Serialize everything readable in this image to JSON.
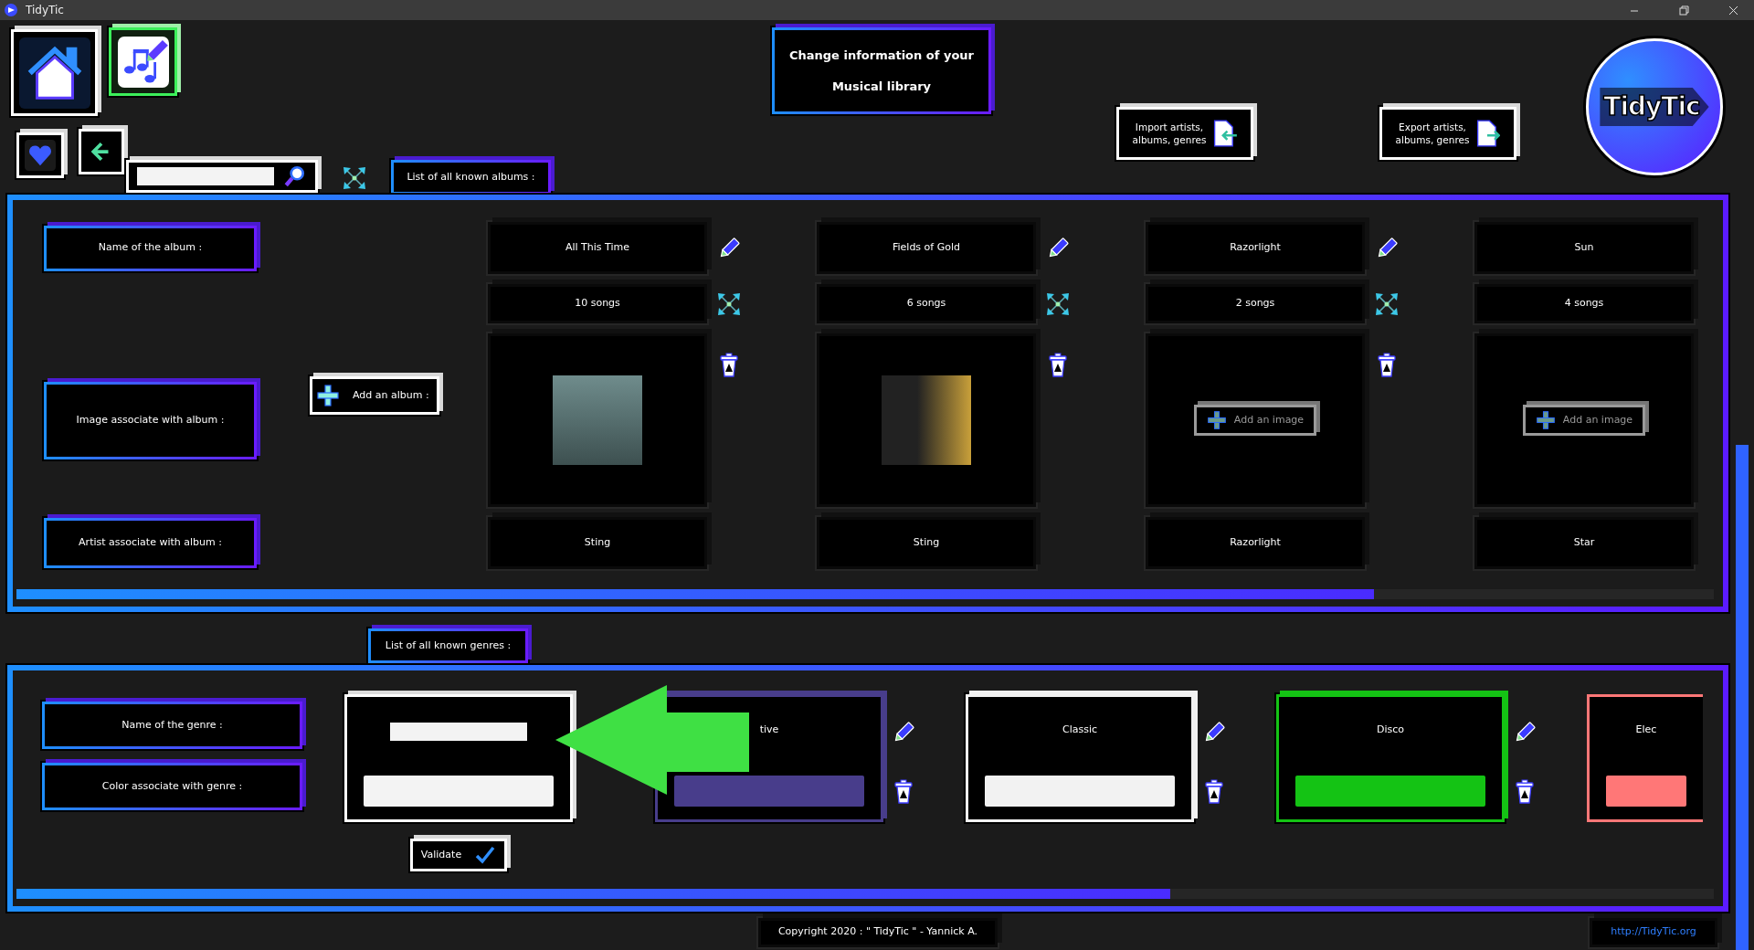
{
  "window": {
    "title": "TidyTic"
  },
  "header": {
    "heading_lines": [
      "Change information of your",
      "Musical library"
    ],
    "import_button_lines": [
      "Import artists,",
      "albums, genres"
    ],
    "export_button_lines": [
      "Export artists,",
      "albums, genres"
    ],
    "logo_text": "TidyTic"
  },
  "albums_tab": "List of all known albums :",
  "album_labels": [
    "Name of the album :",
    "Image associate with album :",
    "Artist associate with album :"
  ],
  "add_album_button": "Add an album :",
  "albums": [
    {
      "name": "All This Time",
      "songs": "10 songs",
      "image": {
        "kind": "photo"
      },
      "artist": "Sting"
    },
    {
      "name": "Fields of Gold",
      "songs": "6 songs",
      "image": {
        "kind": "photo"
      },
      "artist": "Sting"
    },
    {
      "name": "Razorlight",
      "songs": "2 songs",
      "image": {
        "kind": "add",
        "label": "Add an image"
      },
      "artist": "Razorlight"
    },
    {
      "name": "Sun",
      "songs": "4 songs",
      "image": {
        "kind": "add",
        "label": "Add an image"
      },
      "artist": "Star"
    }
  ],
  "genres_tab": "List of all known genres :",
  "genre_labels": [
    "Name of the genre :",
    "Color associate with genre :"
  ],
  "new_genre": {
    "validate_button": "Validate"
  },
  "genres": [
    {
      "name": "tive",
      "color": "#483d8b"
    },
    {
      "name": "Classic",
      "color": "#f2f2f2"
    },
    {
      "name": "Disco",
      "color": "#14c314"
    },
    {
      "name": "Elec",
      "color": "#ff7777"
    }
  ],
  "footer": {
    "copyright": "Copyright 2020 : \" TidyTic \" - Yannick A.",
    "link": "http://TidyTic.org"
  }
}
